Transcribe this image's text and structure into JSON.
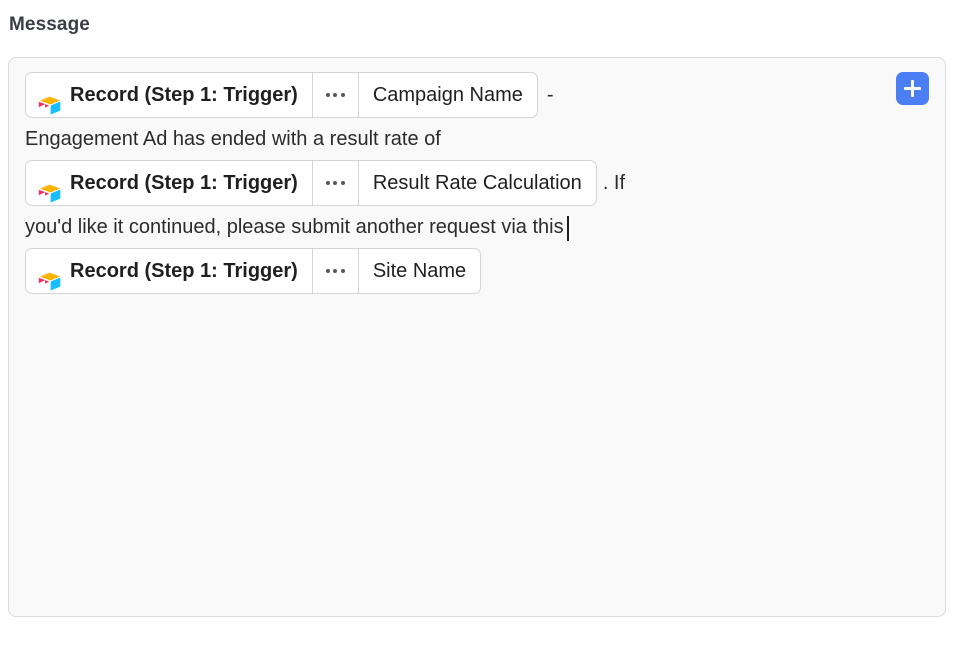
{
  "field": {
    "label": "Message"
  },
  "toolbar": {
    "add_token_label": "+",
    "add_token_icon": "plus-icon",
    "accent_color": "#4c7ef3"
  },
  "editor": {
    "placeholder": "Enter a message",
    "caret_visible": true,
    "panel_background": "#f9f9f9",
    "panel_border_color": "#dcdcdc",
    "lines": [
      {
        "type": "token-line",
        "token": {
          "source_label": "Record (Step 1: Trigger)",
          "source_icon": "airtable-icon",
          "more_icon": "ellipsis-icon",
          "field_label": "Campaign Name"
        },
        "trailing_text": "-"
      },
      {
        "type": "text-line",
        "text": "Engagement Ad has ended with a result rate of"
      },
      {
        "type": "token-line",
        "token": {
          "source_label": "Record (Step 1: Trigger)",
          "source_icon": "airtable-icon",
          "more_icon": "ellipsis-icon",
          "field_label": "Result Rate Calculation"
        },
        "trailing_text": ". If"
      },
      {
        "type": "text-line",
        "text": "you'd like it continued, please submit another request via this"
      },
      {
        "type": "token-line",
        "token": {
          "source_label": "Record (Step 1: Trigger)",
          "source_icon": "airtable-icon",
          "more_icon": "ellipsis-icon",
          "field_label": "Site Name"
        },
        "trailing_text": ""
      }
    ]
  }
}
